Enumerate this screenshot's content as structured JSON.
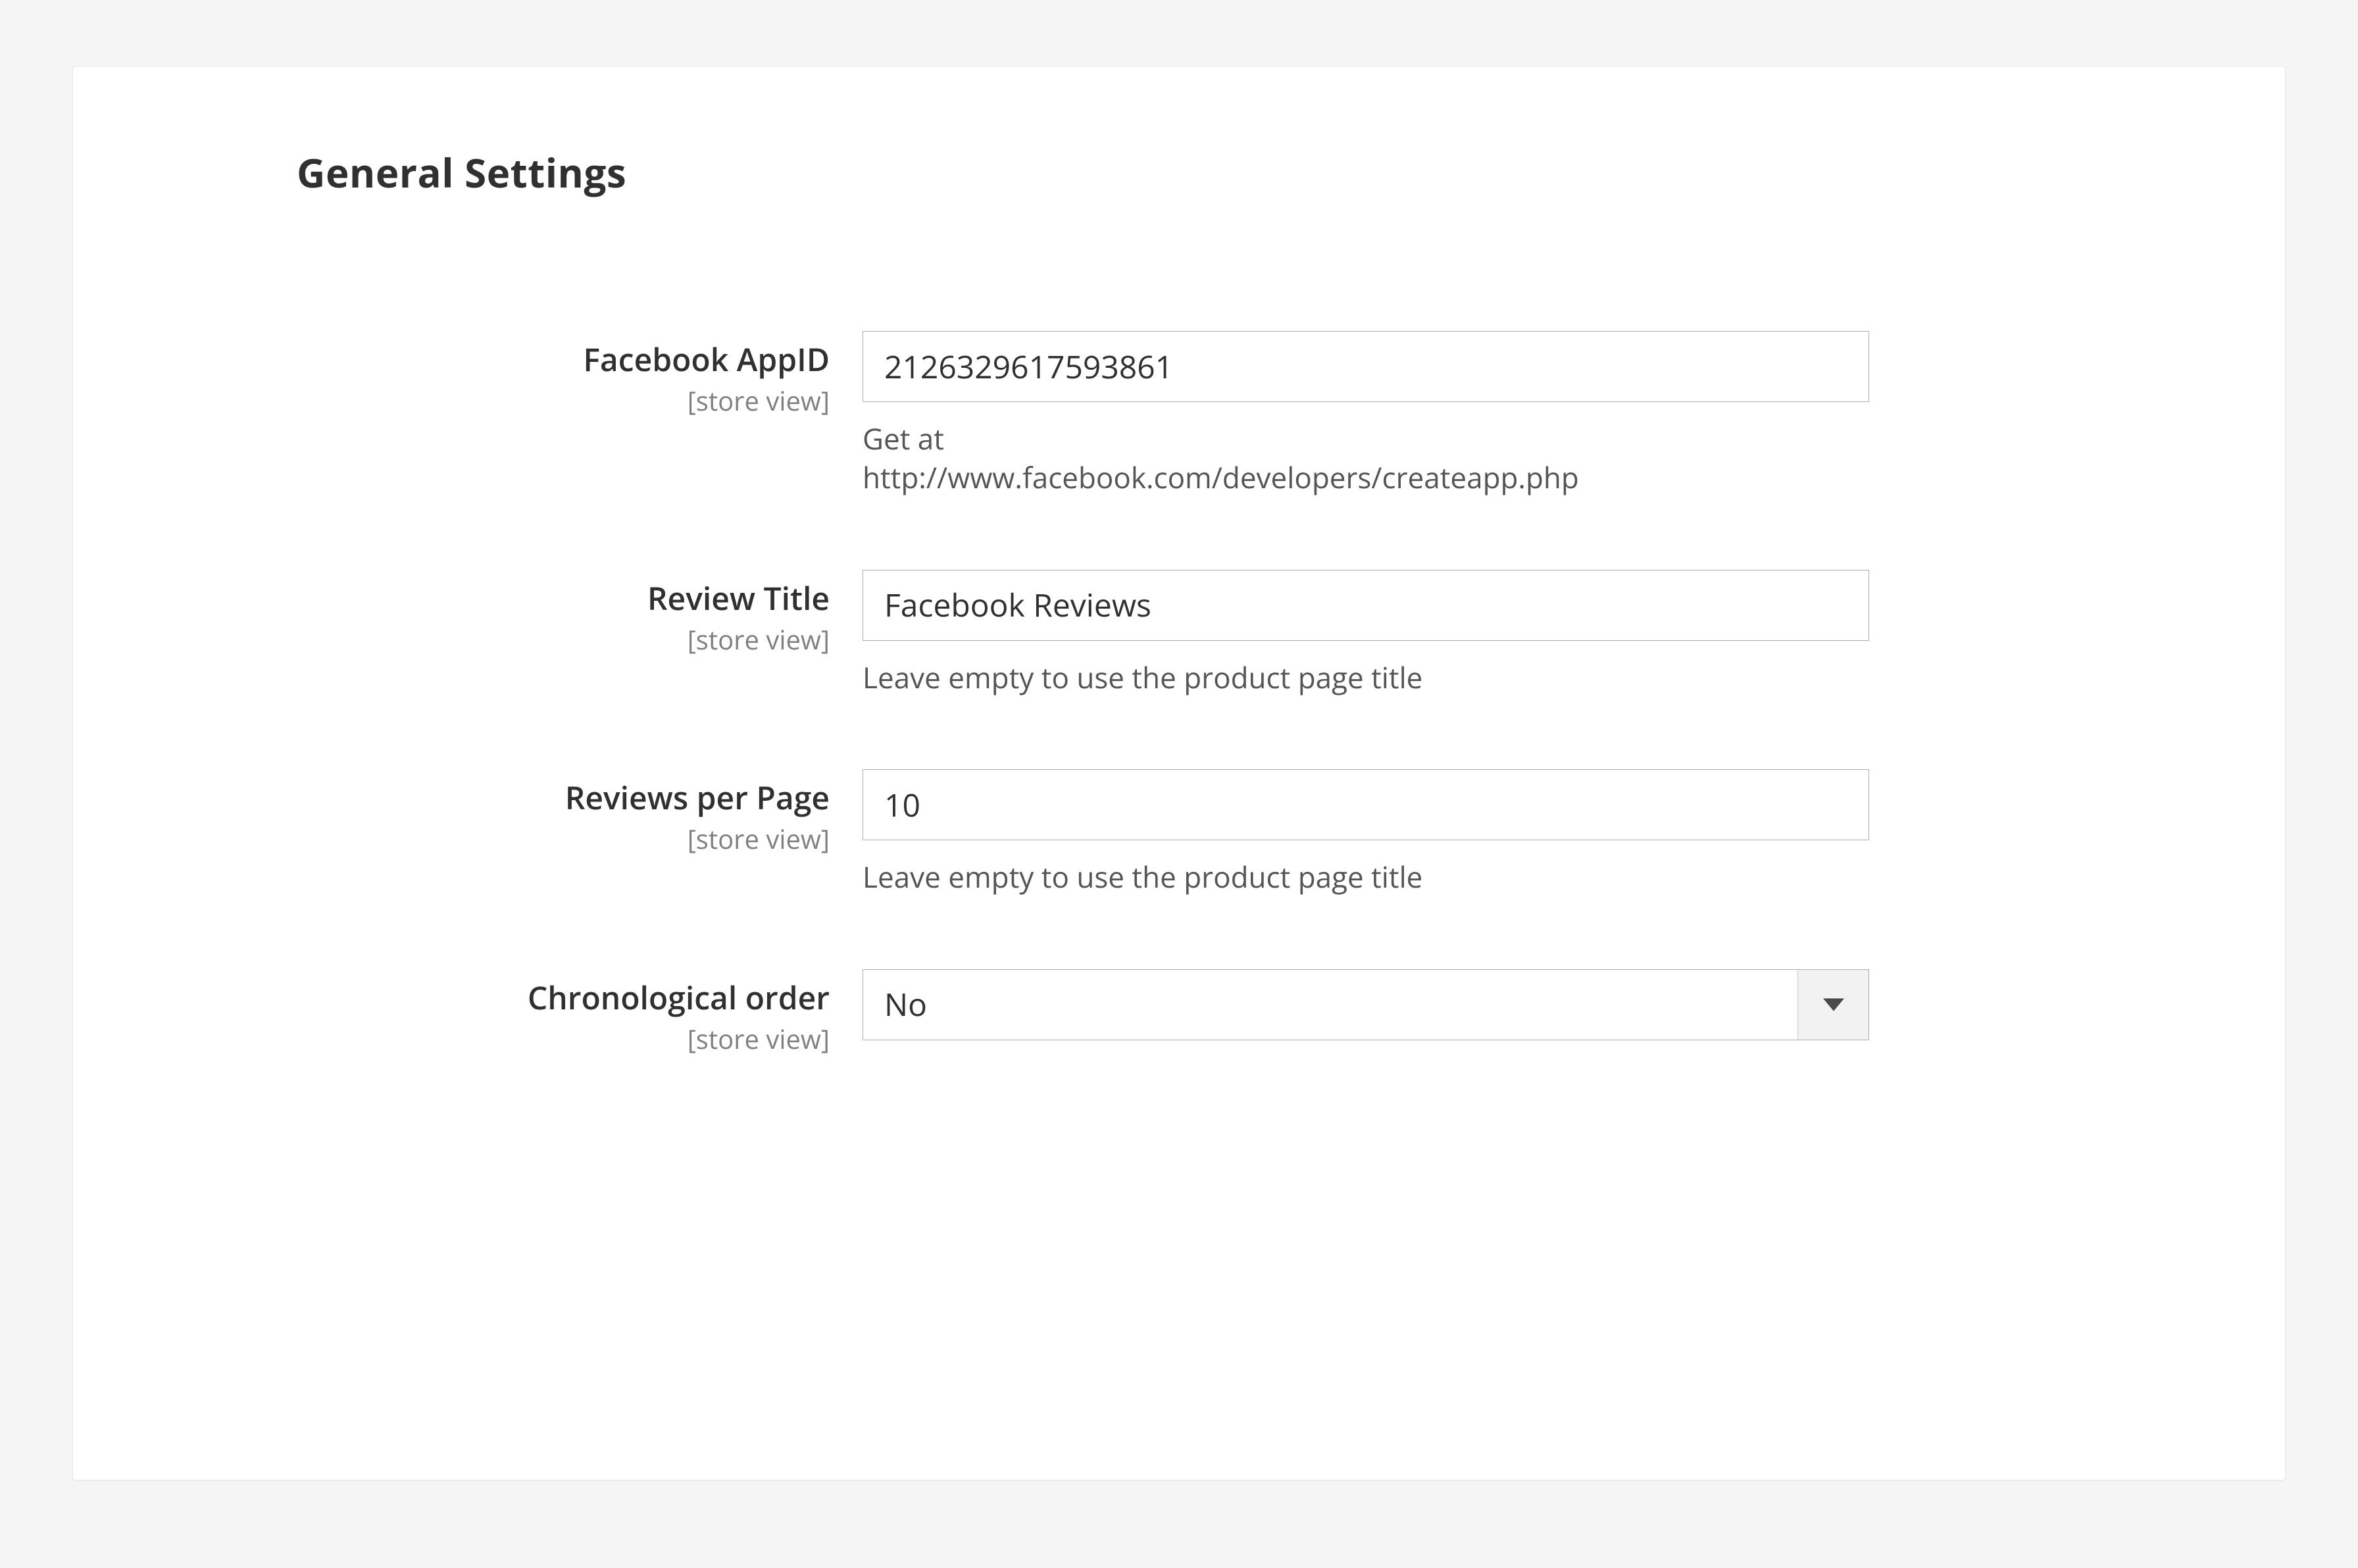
{
  "section": {
    "title": "General Settings",
    "scope_text": "[store view]"
  },
  "fields": {
    "app_id": {
      "label": "Facebook AppID",
      "value": "2126329617593861",
      "note_line1": "Get at",
      "note_line2": "http://www.facebook.com/developers/createapp.php"
    },
    "review_title": {
      "label": "Review Title",
      "value": "Facebook Reviews",
      "note": "Leave empty to use the product page title"
    },
    "per_page": {
      "label": "Reviews per Page",
      "value": "10",
      "note": "Leave empty to use the product page title"
    },
    "chron_order": {
      "label": "Chronological order",
      "value": "No"
    }
  }
}
